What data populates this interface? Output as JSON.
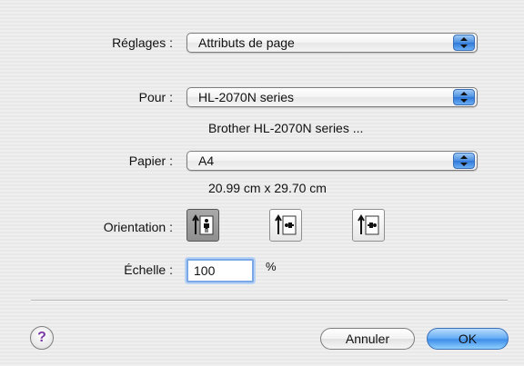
{
  "settings": {
    "label": "Réglages :",
    "value": "Attributs de page"
  },
  "format_for": {
    "label": "Pour :",
    "value": "HL-2070N series",
    "description": "Brother HL-2070N series ..."
  },
  "paper": {
    "label": "Papier :",
    "value": "A4",
    "dimensions": "20.99 cm x 29.70 cm"
  },
  "orientation": {
    "label": "Orientation :",
    "options": [
      {
        "icon": "portrait-orientation-icon",
        "selected": true
      },
      {
        "icon": "landscape-left-orientation-icon",
        "selected": false
      },
      {
        "icon": "landscape-right-orientation-icon",
        "selected": false
      }
    ]
  },
  "scale": {
    "label": "Échelle :",
    "value": "100",
    "unit": "%"
  },
  "buttons": {
    "help": "?",
    "cancel": "Annuler",
    "ok": "OK"
  },
  "colors": {
    "accent": "#3f8ee8",
    "background": "#ececec"
  }
}
